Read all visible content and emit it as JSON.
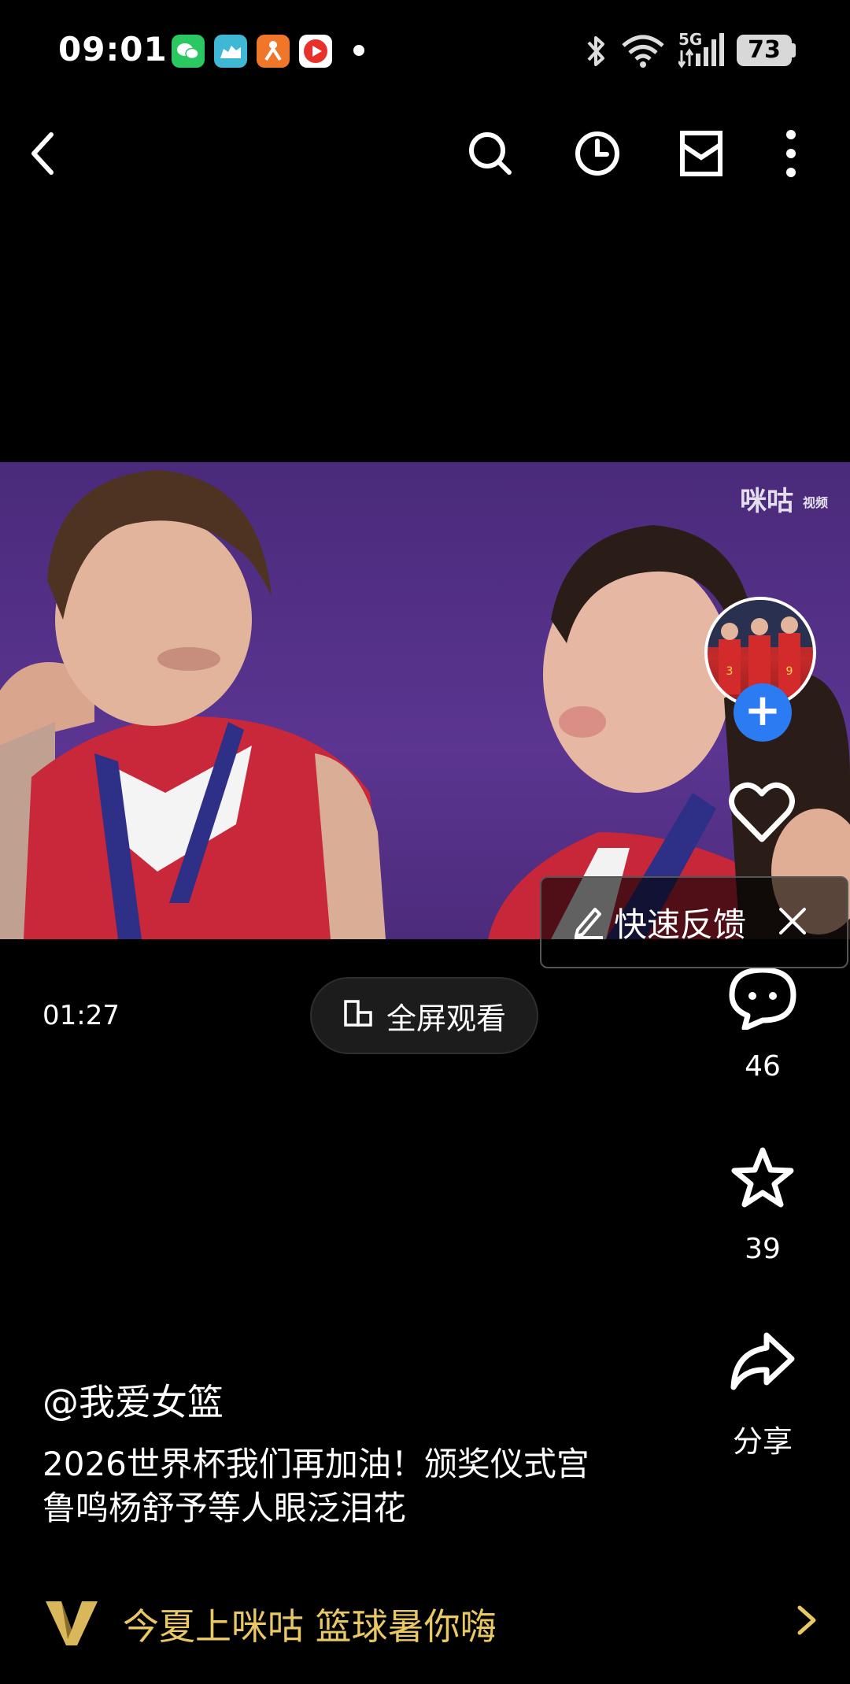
{
  "status_bar": {
    "time": "09:01",
    "network": "5G",
    "battery": "73",
    "app_icons": [
      "wechat-icon",
      "camel-icon",
      "coupon-app-icon",
      "video-app-icon"
    ]
  },
  "nav": {
    "icons": [
      "back-icon",
      "search-icon",
      "history-icon",
      "inbox-icon",
      "more-icon"
    ]
  },
  "video": {
    "watermark": "咪咕",
    "watermark_small": "视频"
  },
  "rail": {
    "like_count": "",
    "comment_count": "46",
    "favorite_count": "39",
    "share_label": "分享"
  },
  "feedback": {
    "label": "快速反馈"
  },
  "player": {
    "timecode": "01:27",
    "fullscreen_label": "全屏观看"
  },
  "post": {
    "author": "@我爱女篮",
    "description_lines": [
      "2026世界杯我们再加油！颁奖仪式宫",
      "鲁鸣杨舒予等人眼泛泪花"
    ]
  },
  "promo": {
    "text": "今夏上咪咕 篮球暑你嗨"
  },
  "colors": {
    "accent_blue": "#2b7bf2",
    "promo_gold": "#e8c764",
    "video_bg": "#5b3591"
  }
}
